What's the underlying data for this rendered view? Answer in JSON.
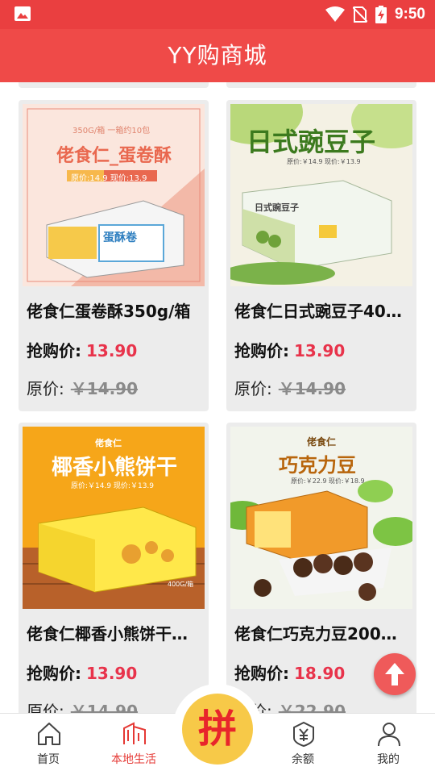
{
  "status_bar": {
    "time": "9:50"
  },
  "app_bar": {
    "title": "YY购商城"
  },
  "products": [
    {
      "name": "佬食仁蛋卷酥350g/箱",
      "sale_label": "抢购价:",
      "sale_price": "13.90",
      "orig_label": "原价:",
      "orig_price": "￥14.90",
      "img": {
        "top_text": "350G/箱 一箱约10包",
        "title": "佬食仁_蛋卷酥",
        "price_text": "原价:14.9 现价:13.9",
        "box_text": "蛋酥卷"
      }
    },
    {
      "name": "佬食仁日式豌豆子40…",
      "sale_label": "抢购价:",
      "sale_price": "13.90",
      "orig_label": "原价:",
      "orig_price": "￥14.90",
      "img": {
        "title": "日式豌豆子",
        "price_text": "原价:￥14.9 现价:￥13.9",
        "box_text": "日式豌豆子"
      }
    },
    {
      "name": "佬食仁椰香小熊饼干…",
      "sale_label": "抢购价:",
      "sale_price": "13.90",
      "orig_label": "原价:",
      "orig_price": "￥14.90",
      "img": {
        "brand": "佬食仁",
        "title": "椰香小熊饼干",
        "price_text": "原价:￥14.9 现价:￥13.9",
        "weight": "400G/箱"
      }
    },
    {
      "name": "佬食仁巧克力豆200…",
      "sale_label": "抢购价:",
      "sale_price": "18.90",
      "orig_label": "原价:",
      "orig_price": "￥22.90",
      "img": {
        "brand": "佬食仁",
        "title": "巧克力豆",
        "price_text": "原价:￥22.9 现价:￥18.9"
      }
    }
  ],
  "tabs": [
    {
      "label": "首页",
      "icon": "home-icon"
    },
    {
      "label": "本地生活",
      "icon": "building-icon"
    },
    {
      "label": "拼",
      "icon": "group-buy-icon"
    },
    {
      "label": "余额",
      "icon": "yen-shield-icon"
    },
    {
      "label": "我的",
      "icon": "person-icon"
    }
  ],
  "colors": {
    "primary": "#ef4a48",
    "price": "#e8334b",
    "active_tab": "#e53935"
  }
}
